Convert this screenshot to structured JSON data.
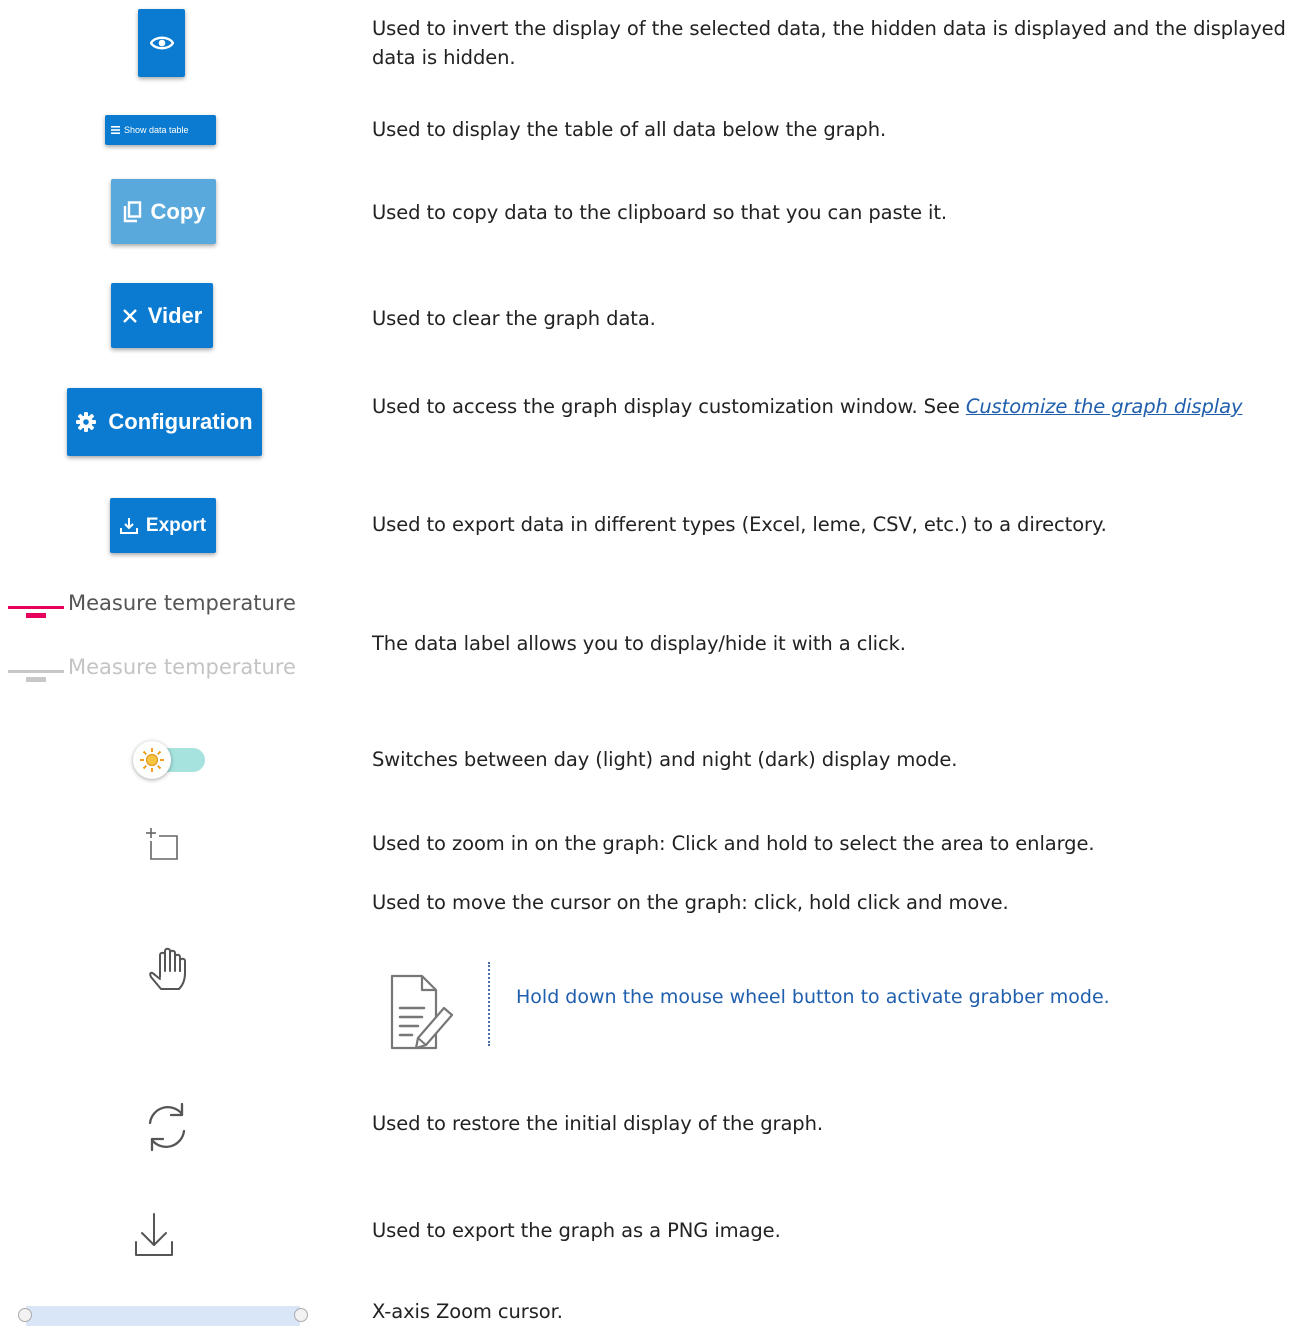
{
  "rows": {
    "invert": {
      "description": "Used to invert the display of the selected data, the hidden data is displayed and the displayed data is hidden.",
      "icon": "eye-icon"
    },
    "data_table": {
      "button_label": "Show data table",
      "description": "Used to display the table of all data below the graph.",
      "icon": "list-icon"
    },
    "copy": {
      "button_label": "Copy",
      "description": "Used to copy data to the clipboard so that you can paste it.",
      "icon": "copy-icon"
    },
    "clear": {
      "button_label": "Vider",
      "description": "Used to clear the graph data.",
      "icon": "close-icon"
    },
    "configuration": {
      "button_label": "Configuration",
      "description_prefix": "Used to access the graph display customization window. See ",
      "link_text": "Customize the graph display",
      "icon": "gear-icon"
    },
    "export": {
      "button_label": "Export",
      "description": "Used to export data in different types (Excel, leme, CSV, etc.) to a directory.",
      "icon": "download-icon"
    },
    "legend": {
      "label_active": "Measure temperature",
      "label_inactive": "Measure temperature",
      "description": "The data label allows you to display/hide it with a click.",
      "active_color": "#e6005c",
      "inactive_color": "#c8c8c8"
    },
    "theme": {
      "description": "Switches between day (light) and night (dark) display mode.",
      "icon": "sun-icon"
    },
    "zoom": {
      "description": "Used to zoom in on the graph: Click and hold to select the area to enlarge.",
      "icon": "zoom-select-icon"
    },
    "move": {
      "description": "Used to move the cursor on the graph: click, hold click and move.",
      "icon": "hand-icon",
      "note": "Hold down the mouse wheel button to activate grabber mode.",
      "note_icon": "note-edit-icon"
    },
    "restore": {
      "description": "Used to restore the initial display of the graph.",
      "icon": "refresh-icon"
    },
    "png": {
      "description": "Used to export the graph as a PNG image.",
      "icon": "save-icon"
    },
    "xzoom": {
      "description": "X-axis Zoom cursor.",
      "icon": "slider-icon"
    }
  },
  "colors": {
    "button_blue": "#0a7bd0",
    "copy_blue": "#5aa9dd",
    "link_blue": "#1f5fae"
  }
}
